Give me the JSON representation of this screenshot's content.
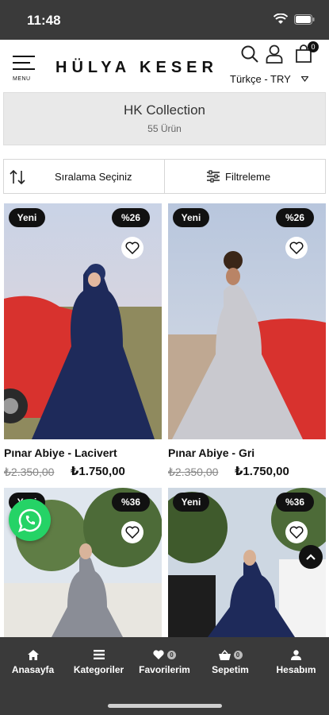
{
  "status": {
    "time": "11:48"
  },
  "header": {
    "menu_label": "MENU",
    "brand": "HÜLYA KESER",
    "cart_count": "0",
    "language_currency": "Türkçe - TRY"
  },
  "collection": {
    "title": "HK Collection",
    "count": "55 Ürün"
  },
  "toolbar": {
    "sort_label": "Sıralama Seçiniz",
    "filter_label": "Filtreleme"
  },
  "products": [
    {
      "badge_new": "Yeni",
      "badge_discount": "%26",
      "name": "Pınar Abiye - Lacivert",
      "old_price": "₺2.350,00",
      "new_price": "₺1.750,00",
      "dress_color": "#1e2a5a"
    },
    {
      "badge_new": "Yeni",
      "badge_discount": "%26",
      "name": "Pınar Abiye - Gri",
      "old_price": "₺2.350,00",
      "new_price": "₺1.750,00",
      "dress_color": "#c9c9cf"
    },
    {
      "badge_new": "Yeni",
      "badge_discount": "%36"
    },
    {
      "badge_new": "Yeni",
      "badge_discount": "%36"
    }
  ],
  "bottom_nav": [
    {
      "label": "Anasayfa",
      "icon": "home-icon"
    },
    {
      "label": "Kategoriler",
      "icon": "list-icon"
    },
    {
      "label": "Favorilerim",
      "icon": "heart-icon",
      "badge": "0"
    },
    {
      "label": "Sepetim",
      "icon": "basket-icon",
      "badge": "0"
    },
    {
      "label": "Hesabım",
      "icon": "user-icon"
    }
  ],
  "colors": {
    "dark_bar": "#3a3a3a",
    "whatsapp": "#25d366",
    "badge_bg": "#111111"
  }
}
